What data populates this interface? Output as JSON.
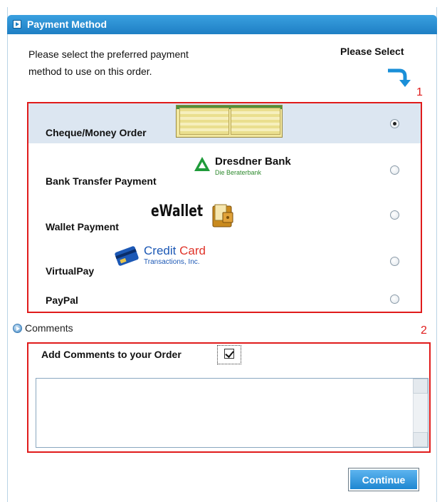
{
  "header": {
    "title": "Payment Method"
  },
  "intro": {
    "text": "Please select the preferred payment method to use on this order.",
    "please_select": "Please Select"
  },
  "annotations": {
    "one": "1",
    "two": "2"
  },
  "payment_methods": [
    {
      "label": "Cheque/Money Order",
      "selected": true
    },
    {
      "label": "Bank Transfer Payment",
      "selected": false,
      "logo_title": "Dresdner Bank",
      "logo_subtitle": "Die Beraterbank"
    },
    {
      "label": "Wallet Payment",
      "selected": false,
      "logo_title": "eWallet"
    },
    {
      "label": "VirtualPay",
      "selected": false,
      "logo_title_a": "Credit",
      "logo_title_b": "Card",
      "logo_subtitle": "Transactions, Inc."
    },
    {
      "label": "PayPal",
      "selected": false
    }
  ],
  "comments": {
    "section_label": "Comments",
    "add_label": "Add Comments to your Order",
    "add_checked": true,
    "textarea_value": ""
  },
  "actions": {
    "continue_label": "Continue"
  },
  "colors": {
    "header": "#1f7fc4",
    "highlight": "#e01b1b",
    "selected_row": "#dce6f1"
  }
}
